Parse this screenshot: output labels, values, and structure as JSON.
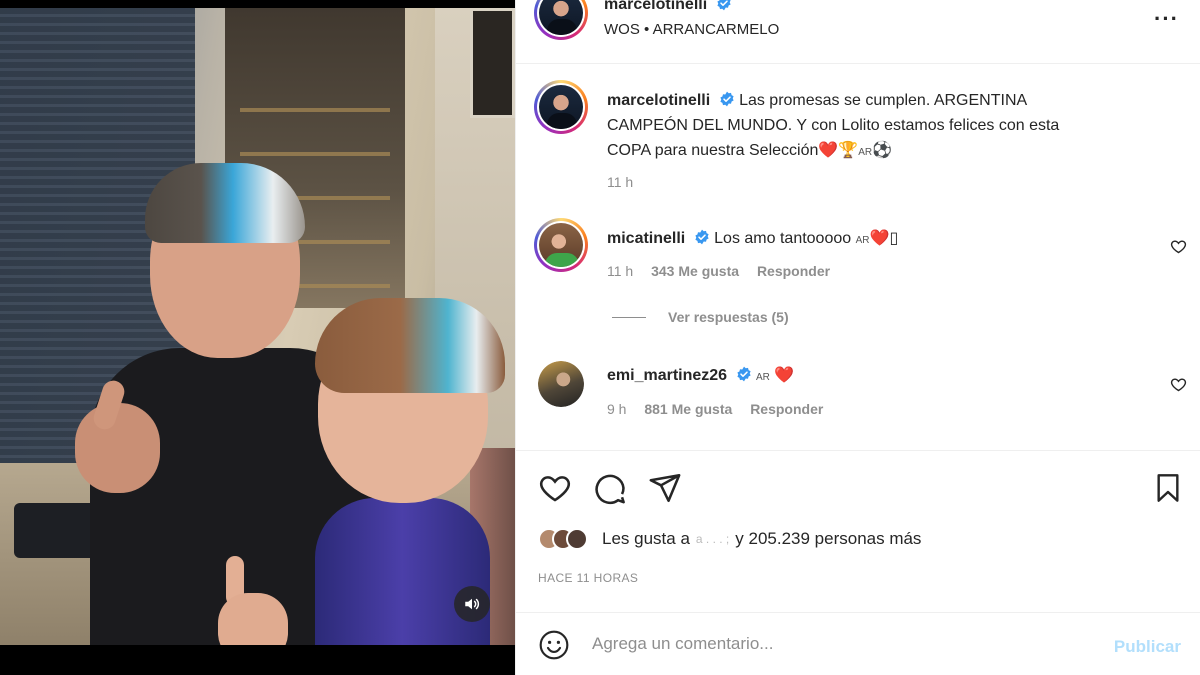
{
  "post": {
    "author": "marcelotinelli",
    "audio": "WOS • ARRANCARMELO",
    "more_icon": "more-dots-icon",
    "verified_color": "#3897f0"
  },
  "caption": {
    "username": "marcelotinelli",
    "text_1": "Las promesas se cumplen. ARGENTINA",
    "text_2": "CAMPEÓN DEL MUNDO. Y con Lolito estamos felices con esta",
    "text_3": "COPA para nuestra Selección",
    "emoji_tail": "❤️🏆",
    "flag": "AR",
    "ball": "⚽",
    "time": "11 h"
  },
  "comments": [
    {
      "username": "micatinelli",
      "text": "Los amo tantooooo",
      "flag": "AR",
      "heart": "❤️",
      "glyph": "▯",
      "time": "11 h",
      "likes": "343 Me gusta",
      "reply": "Responder",
      "view_replies": "Ver respuestas (5)"
    },
    {
      "username": "emi_martinez26",
      "flag": "AR",
      "heart": "❤️",
      "time": "9 h",
      "likes": "881 Me gusta",
      "reply": "Responder"
    }
  ],
  "actions": {
    "like_icon": "heart-icon",
    "comment_icon": "comment-icon",
    "share_icon": "paper-plane-icon",
    "save_icon": "bookmark-icon"
  },
  "likes": {
    "prefix": "Les gusta a",
    "redacted": "a . .       . ;",
    "suffix": "y 205.239 personas más"
  },
  "posted": "HACE 11 HORAS",
  "composer": {
    "placeholder": "Agrega un comentario...",
    "publish": "Publicar",
    "emoji_icon": "smiley-icon"
  },
  "colors": {
    "accent": "#0095f6",
    "publish_disabled": "#b2dffc",
    "meta": "#8e8e8e"
  }
}
